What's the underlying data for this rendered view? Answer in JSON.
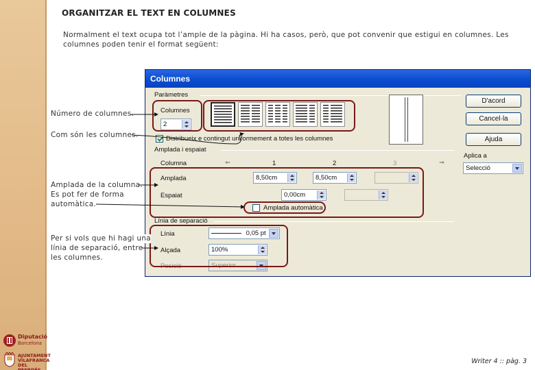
{
  "heading": "ORGANITZAR EL TEXT EN COLUMNES",
  "intro": "Normalment el text ocupa tot l’ample de la pàgina. Hi ha casos, però, que pot convenir que estigui en columnes. Les columnes poden tenir el format següent:",
  "dialog": {
    "title": "Columnes",
    "parameters_label": "Paràmetres",
    "columns_label": "Columnes",
    "columns_value": "2",
    "distribute_label": "Distribueix e contingut uniformement a totes les columnes",
    "width_spacing_label": "Amplada i espaiat",
    "col_header": "Columna",
    "col_numbers": [
      "1",
      "2",
      "3"
    ],
    "width_label": "Amplada",
    "width_values": [
      "8,50cm",
      "8,50cm",
      ""
    ],
    "spacing_label": "Espaiat",
    "spacing_value": "0,00cm",
    "auto_width_label": "Amplada automàtica",
    "separator_label": "Línia de separació",
    "line_label": "Línia",
    "line_value": "0,05 pt",
    "height_label": "Alçada",
    "height_value": "100%",
    "position_label": "Posició",
    "position_value": "Superior",
    "ok_button": "D'acord",
    "cancel_button": "Cancel·la",
    "help_button": "Ajuda",
    "apply_label": "Aplica a",
    "apply_value": "Selecció"
  },
  "annotations": {
    "num_columns": "Número de columnes.",
    "how_columns": "Com són les columnes.",
    "width_line1": "Amplada de la columna.",
    "width_line2": "Es pot fer de forma",
    "width_line3": "automàtica.",
    "sep_line1": "Per si vols que hi hagi una",
    "sep_line2": "línia de separació, entre",
    "sep_line3": "les columnes."
  },
  "logos": {
    "diputacio_line1": "Diputació",
    "diputacio_line2": "Barcelona",
    "ajuntament_line1": "AJUNTAMENT",
    "ajuntament_line2": "VILAFRANCA",
    "ajuntament_line3": "DEL PENEDÈS"
  },
  "footer": "Writer 4 :: pàg. 3",
  "colors": {
    "sidebar": "#e2b987",
    "highlight": "#7a1717",
    "dialog_bg": "#ece9d8",
    "titlebar": "#0c4fd1"
  }
}
